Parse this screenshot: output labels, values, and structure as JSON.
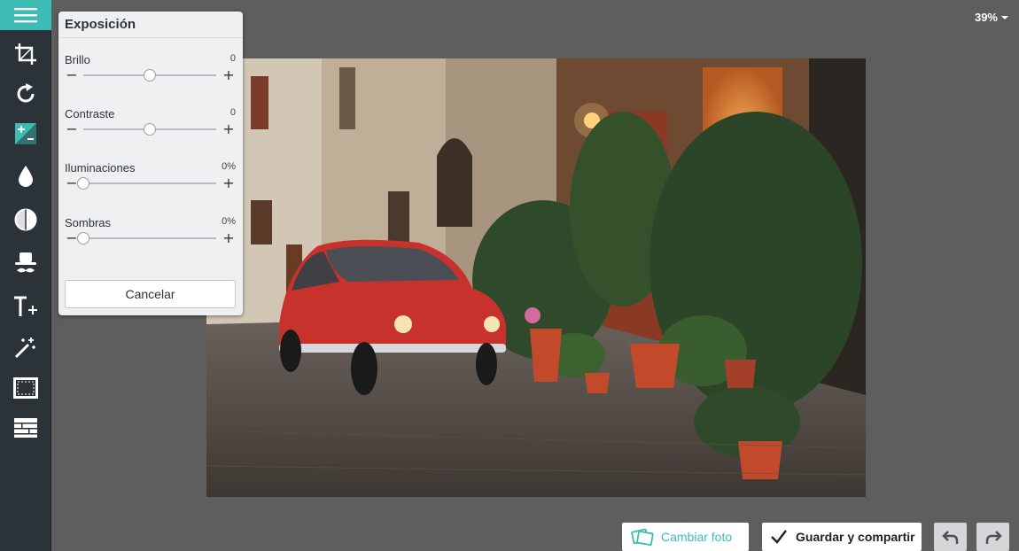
{
  "toolbar": {
    "items": [
      {
        "id": "menu",
        "icon": "hamburger-menu-icon"
      },
      {
        "id": "crop",
        "icon": "crop-icon"
      },
      {
        "id": "rotate",
        "icon": "rotate-icon"
      },
      {
        "id": "exposure",
        "icon": "exposure-icon",
        "active": true
      },
      {
        "id": "color",
        "icon": "droplet-icon"
      },
      {
        "id": "contrast",
        "icon": "half-circle-icon"
      },
      {
        "id": "disguise",
        "icon": "hat-mustache-icon"
      },
      {
        "id": "text",
        "icon": "text-plus-icon"
      },
      {
        "id": "effects",
        "icon": "magic-wand-icon"
      },
      {
        "id": "frames",
        "icon": "frame-icon"
      },
      {
        "id": "textures",
        "icon": "brick-texture-icon"
      }
    ]
  },
  "zoom": {
    "label": "39%"
  },
  "panel": {
    "title": "Exposición",
    "adjustments": [
      {
        "label": "Brillo",
        "value": "0",
        "level": 0.5
      },
      {
        "label": "Contraste",
        "value": "0",
        "level": 0.5
      },
      {
        "label": "Iluminaciones",
        "value": "0%",
        "level": 0.0
      },
      {
        "label": "Sombras",
        "value": "0%",
        "level": 0.0
      }
    ],
    "cancel_label": "Cancelar"
  },
  "bottom": {
    "change_photo_label": "Cambiar foto",
    "save_share_label": "Guardar y compartir",
    "undo_icon": "undo-icon",
    "redo_icon": "redo-icon"
  },
  "colors": {
    "accent": "#3dbcb6",
    "toolbar_bg": "#2b3238",
    "workspace_bg": "#5e5e5e",
    "panel_bg": "#eef0f1"
  }
}
